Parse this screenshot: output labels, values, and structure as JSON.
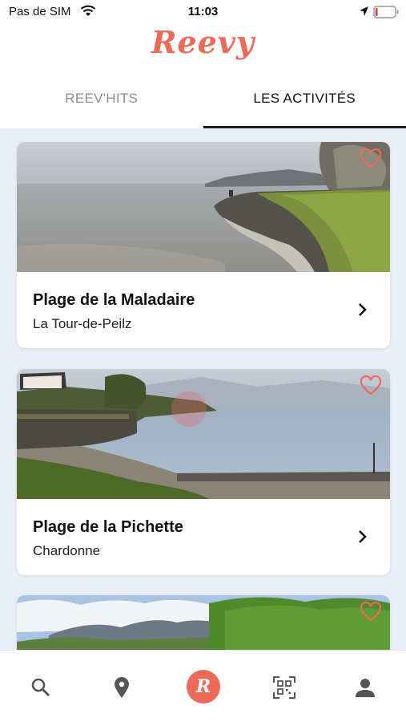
{
  "status_bar": {
    "carrier": "Pas de SIM",
    "time": "11:03"
  },
  "header": {
    "logo": "Reevy"
  },
  "tabs": [
    {
      "label": "REEV'HITS",
      "active": false
    },
    {
      "label": "LES ACTIVITÉS",
      "active": true
    }
  ],
  "cards": [
    {
      "title": "Plage de la Maladaire",
      "subtitle": "La Tour-de-Peilz"
    },
    {
      "title": "Plage de la Pichette",
      "subtitle": "Chardonne"
    },
    {
      "title": "",
      "subtitle": ""
    }
  ],
  "nav": {
    "items": [
      {
        "icon": "search-icon"
      },
      {
        "icon": "location-pin-icon"
      },
      {
        "icon": "reevy-logo-icon",
        "label": "R"
      },
      {
        "icon": "qr-code-icon"
      },
      {
        "icon": "user-icon"
      }
    ]
  },
  "colors": {
    "accent": "#ee6a58",
    "background": "#e9eef6"
  }
}
